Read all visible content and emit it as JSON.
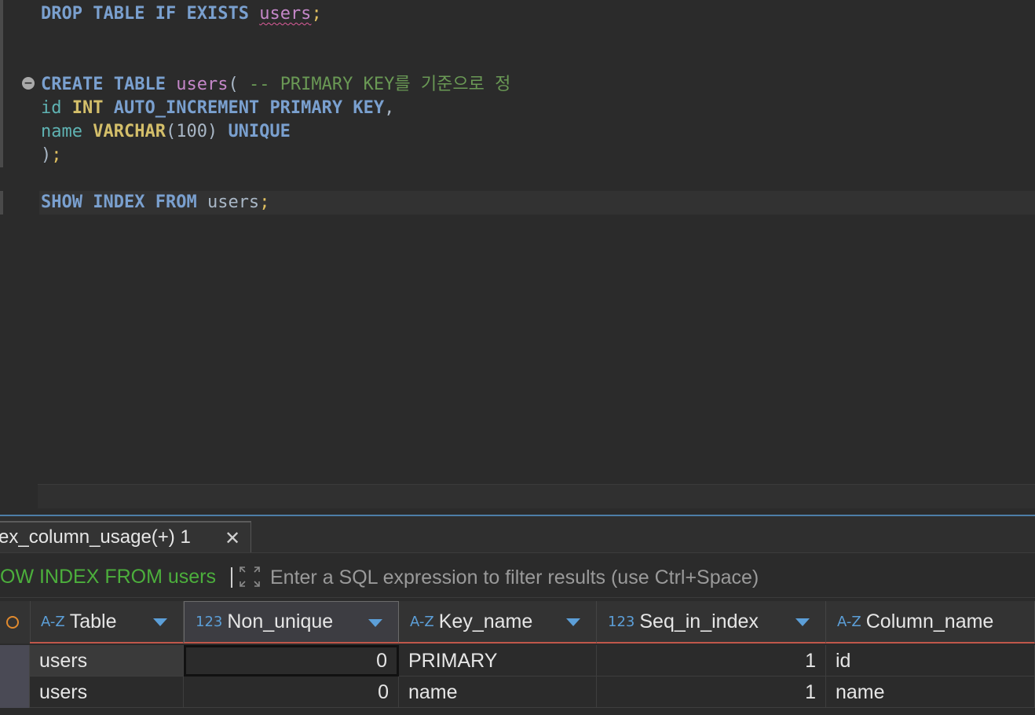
{
  "editor": {
    "line1": {
      "drop": "DROP",
      "table": "TABLE",
      "if": "IF",
      "exists": "EXISTS",
      "name": "users",
      "semi": ";"
    },
    "line2": {
      "create": "CREATE",
      "table": "TABLE",
      "name": "users",
      "paren": "( ",
      "comment": "-- PRIMARY KEY를 기준으로 정"
    },
    "line3": {
      "col": "id",
      "type": "INT",
      "auto": "AUTO_INCREMENT",
      "primary": "PRIMARY",
      "key": "KEY",
      "comma": ","
    },
    "line4": {
      "col": "name",
      "type": "VARCHAR",
      "size": "(100)",
      "unique": "UNIQUE"
    },
    "line5": {
      "close": ")",
      "semi": ";"
    },
    "line6": {
      "show": "SHOW",
      "index": "INDEX",
      "from": "FROM",
      "name": "users",
      "semi": ";"
    }
  },
  "results": {
    "tab_label": "ex_column_usage(+) 1",
    "close_glyph": "✕",
    "query_label": "OW INDEX FROM users",
    "filter_placeholder": "Enter a SQL expression to filter results (use Ctrl+Space)",
    "columns": [
      {
        "icon": "A-Z",
        "title": "Table"
      },
      {
        "icon": "123",
        "title": "Non_unique"
      },
      {
        "icon": "A-Z",
        "title": "Key_name"
      },
      {
        "icon": "123",
        "title": "Seq_in_index"
      },
      {
        "icon": "A-Z",
        "title": "Column_name"
      }
    ],
    "rows": [
      [
        "users",
        "0",
        "PRIMARY",
        "1",
        "id"
      ],
      [
        "users",
        "0",
        "name",
        "1",
        "name"
      ]
    ]
  },
  "colors": {
    "keyword": "#7aa0cf",
    "type": "#d4bf6a",
    "table_name": "#c587c9",
    "column_name": "#5fb3b3",
    "comment": "#6a9955",
    "query_label": "#4caf3c",
    "header_underline": "#c0574a",
    "type_icon": "#5c9fd8"
  }
}
